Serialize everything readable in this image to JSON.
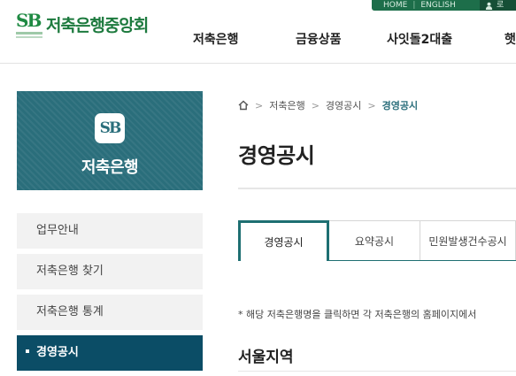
{
  "header": {
    "logo_mark": "SB",
    "logo_text": "저축은행중앙회",
    "top_links": [
      "HOME",
      "ENGLISH"
    ],
    "top_sep": "|",
    "user_label": "로",
    "gnb": [
      "저축은행",
      "금융상품",
      "사잇돌2대출",
      "햇"
    ]
  },
  "banner": {
    "icon_text": "SB",
    "title": "저축은행"
  },
  "lnb": {
    "items": [
      "업무안내",
      "저축은행 찾기",
      "저축은행 통계",
      "경영공시"
    ],
    "active_index": 3
  },
  "breadcrumb": {
    "items": [
      "저축은행",
      "경영공시",
      "경영공시"
    ]
  },
  "page_title": "경영공시",
  "tabs": [
    "경영공시",
    "요약공시",
    "민원발생건수공시"
  ],
  "notice": "* 해당 저축은행명을 클릭하면 각 저축은행의 홈페이지에서",
  "region_title": "서울지역",
  "colors": {
    "brand_green": "#1d7a3e",
    "banner_teal": "#2a6e7b",
    "active_menu": "#0b4d66",
    "tab_accent": "#1e6f72"
  }
}
